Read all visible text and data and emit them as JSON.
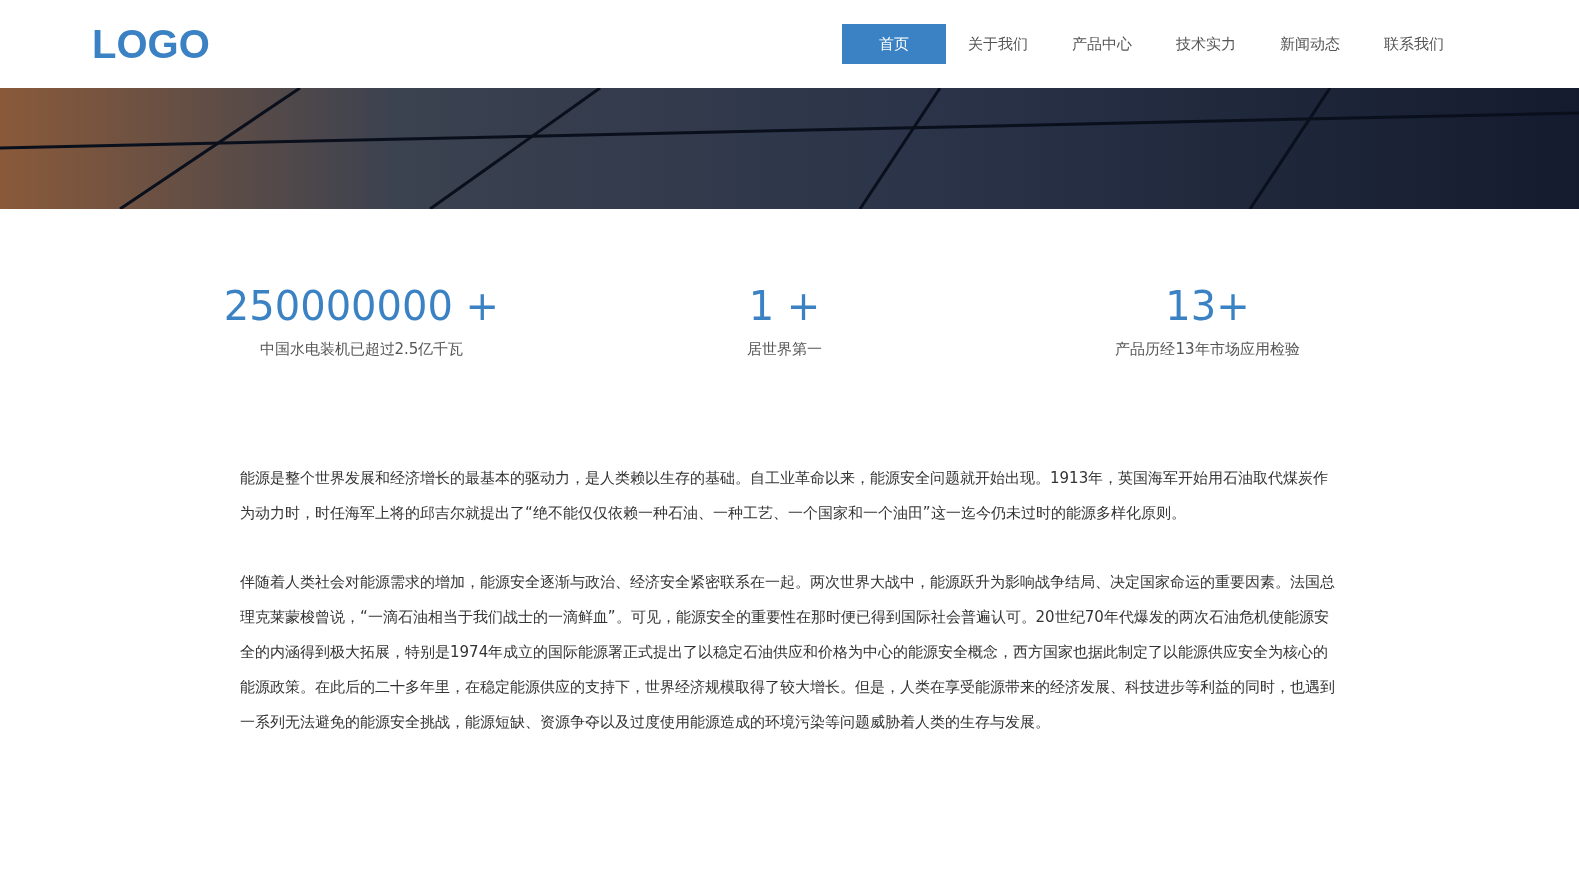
{
  "logo": "LOGO",
  "nav": [
    {
      "label": "首页",
      "selected": true
    },
    {
      "label": "关于我们",
      "selected": false
    },
    {
      "label": "产品中心",
      "selected": false
    },
    {
      "label": "技术实力",
      "selected": false
    },
    {
      "label": "新闻动态",
      "selected": false
    },
    {
      "label": "联系我们",
      "selected": false
    }
  ],
  "stats": [
    {
      "value": "250000000 +",
      "caption": "中国水电装机已超过2.5亿千瓦"
    },
    {
      "value": "1 +",
      "caption": "居世界第一"
    },
    {
      "value": "13+",
      "caption": "产品历经13年市场应用检验"
    }
  ],
  "paragraphs": [
    "能源是整个世界发展和经济增长的最基本的驱动力，是人类赖以生存的基础。自工业革命以来，能源安全问题就开始出现。1913年，英国海军开始用石油取代煤炭作为动力时，时任海军上将的邱吉尔就提出了“绝不能仅仅依赖一种石油、一种工艺、一个国家和一个油田”这一迄今仍未过时的能源多样化原则。",
    "伴随着人类社会对能源需求的增加，能源安全逐渐与政治、经济安全紧密联系在一起。两次世界大战中，能源跃升为影响战争结局、决定国家命运的重要因素。法国总理克莱蒙梭曾说，“一滴石油相当于我们战士的一滴鲜血”。可见，能源安全的重要性在那时便已得到国际社会普遍认可。20世纪70年代爆发的两次石油危机使能源安全的内涵得到极大拓展，特别是1974年成立的国际能源署正式提出了以稳定石油供应和价格为中心的能源安全概念，西方国家也据此制定了以能源供应安全为核心的能源政策。在此后的二十多年里，在稳定能源供应的支持下，世界经济规模取得了较大增长。但是，人类在享受能源带来的经济发展、科技进步等利益的同时，也遇到一系列无法避免的能源安全挑战，能源短缺、资源争夺以及过度使用能源造成的环境污染等问题威胁着人类的生存与发展。"
  ]
}
